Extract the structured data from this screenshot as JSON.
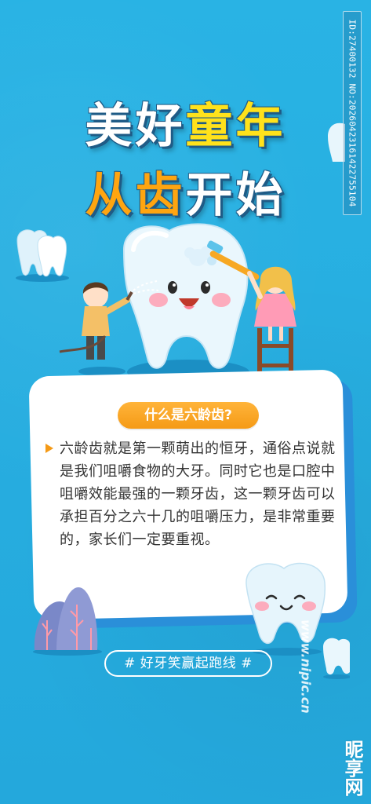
{
  "title": {
    "line1_part1": "美好",
    "line1_part2": "童年",
    "line2_part1": "从齿",
    "line2_part2": "开始"
  },
  "card": {
    "badge": "什么是六龄齿?",
    "paragraph": "六龄齿就是第一颗萌出的恒牙，通俗点说就是我们咀嚼食物的大牙。同时它也是口腔中咀嚼效能最强的一颗牙齿，这一颗牙齿可以承担百分之六十几的咀嚼压力，是非常重要的，家长们一定要重视。"
  },
  "slogan": "# 好牙笑赢起跑线 #",
  "watermark": {
    "id_text": "ID:27400132 NO:20260423161422755104",
    "site": "www.nipic.cn",
    "brand": "昵享网"
  },
  "colors": {
    "background": "#27aee0",
    "accent_yellow": "#ffe21b",
    "accent_orange": "#ffa510",
    "badge": "#f59a16",
    "card": "#ffffff"
  },
  "icons": [
    "tooth-illustration",
    "boy-with-water-hose",
    "girl-on-ladder",
    "toothbrush",
    "small-tooth-mascot",
    "tree-decoration"
  ]
}
